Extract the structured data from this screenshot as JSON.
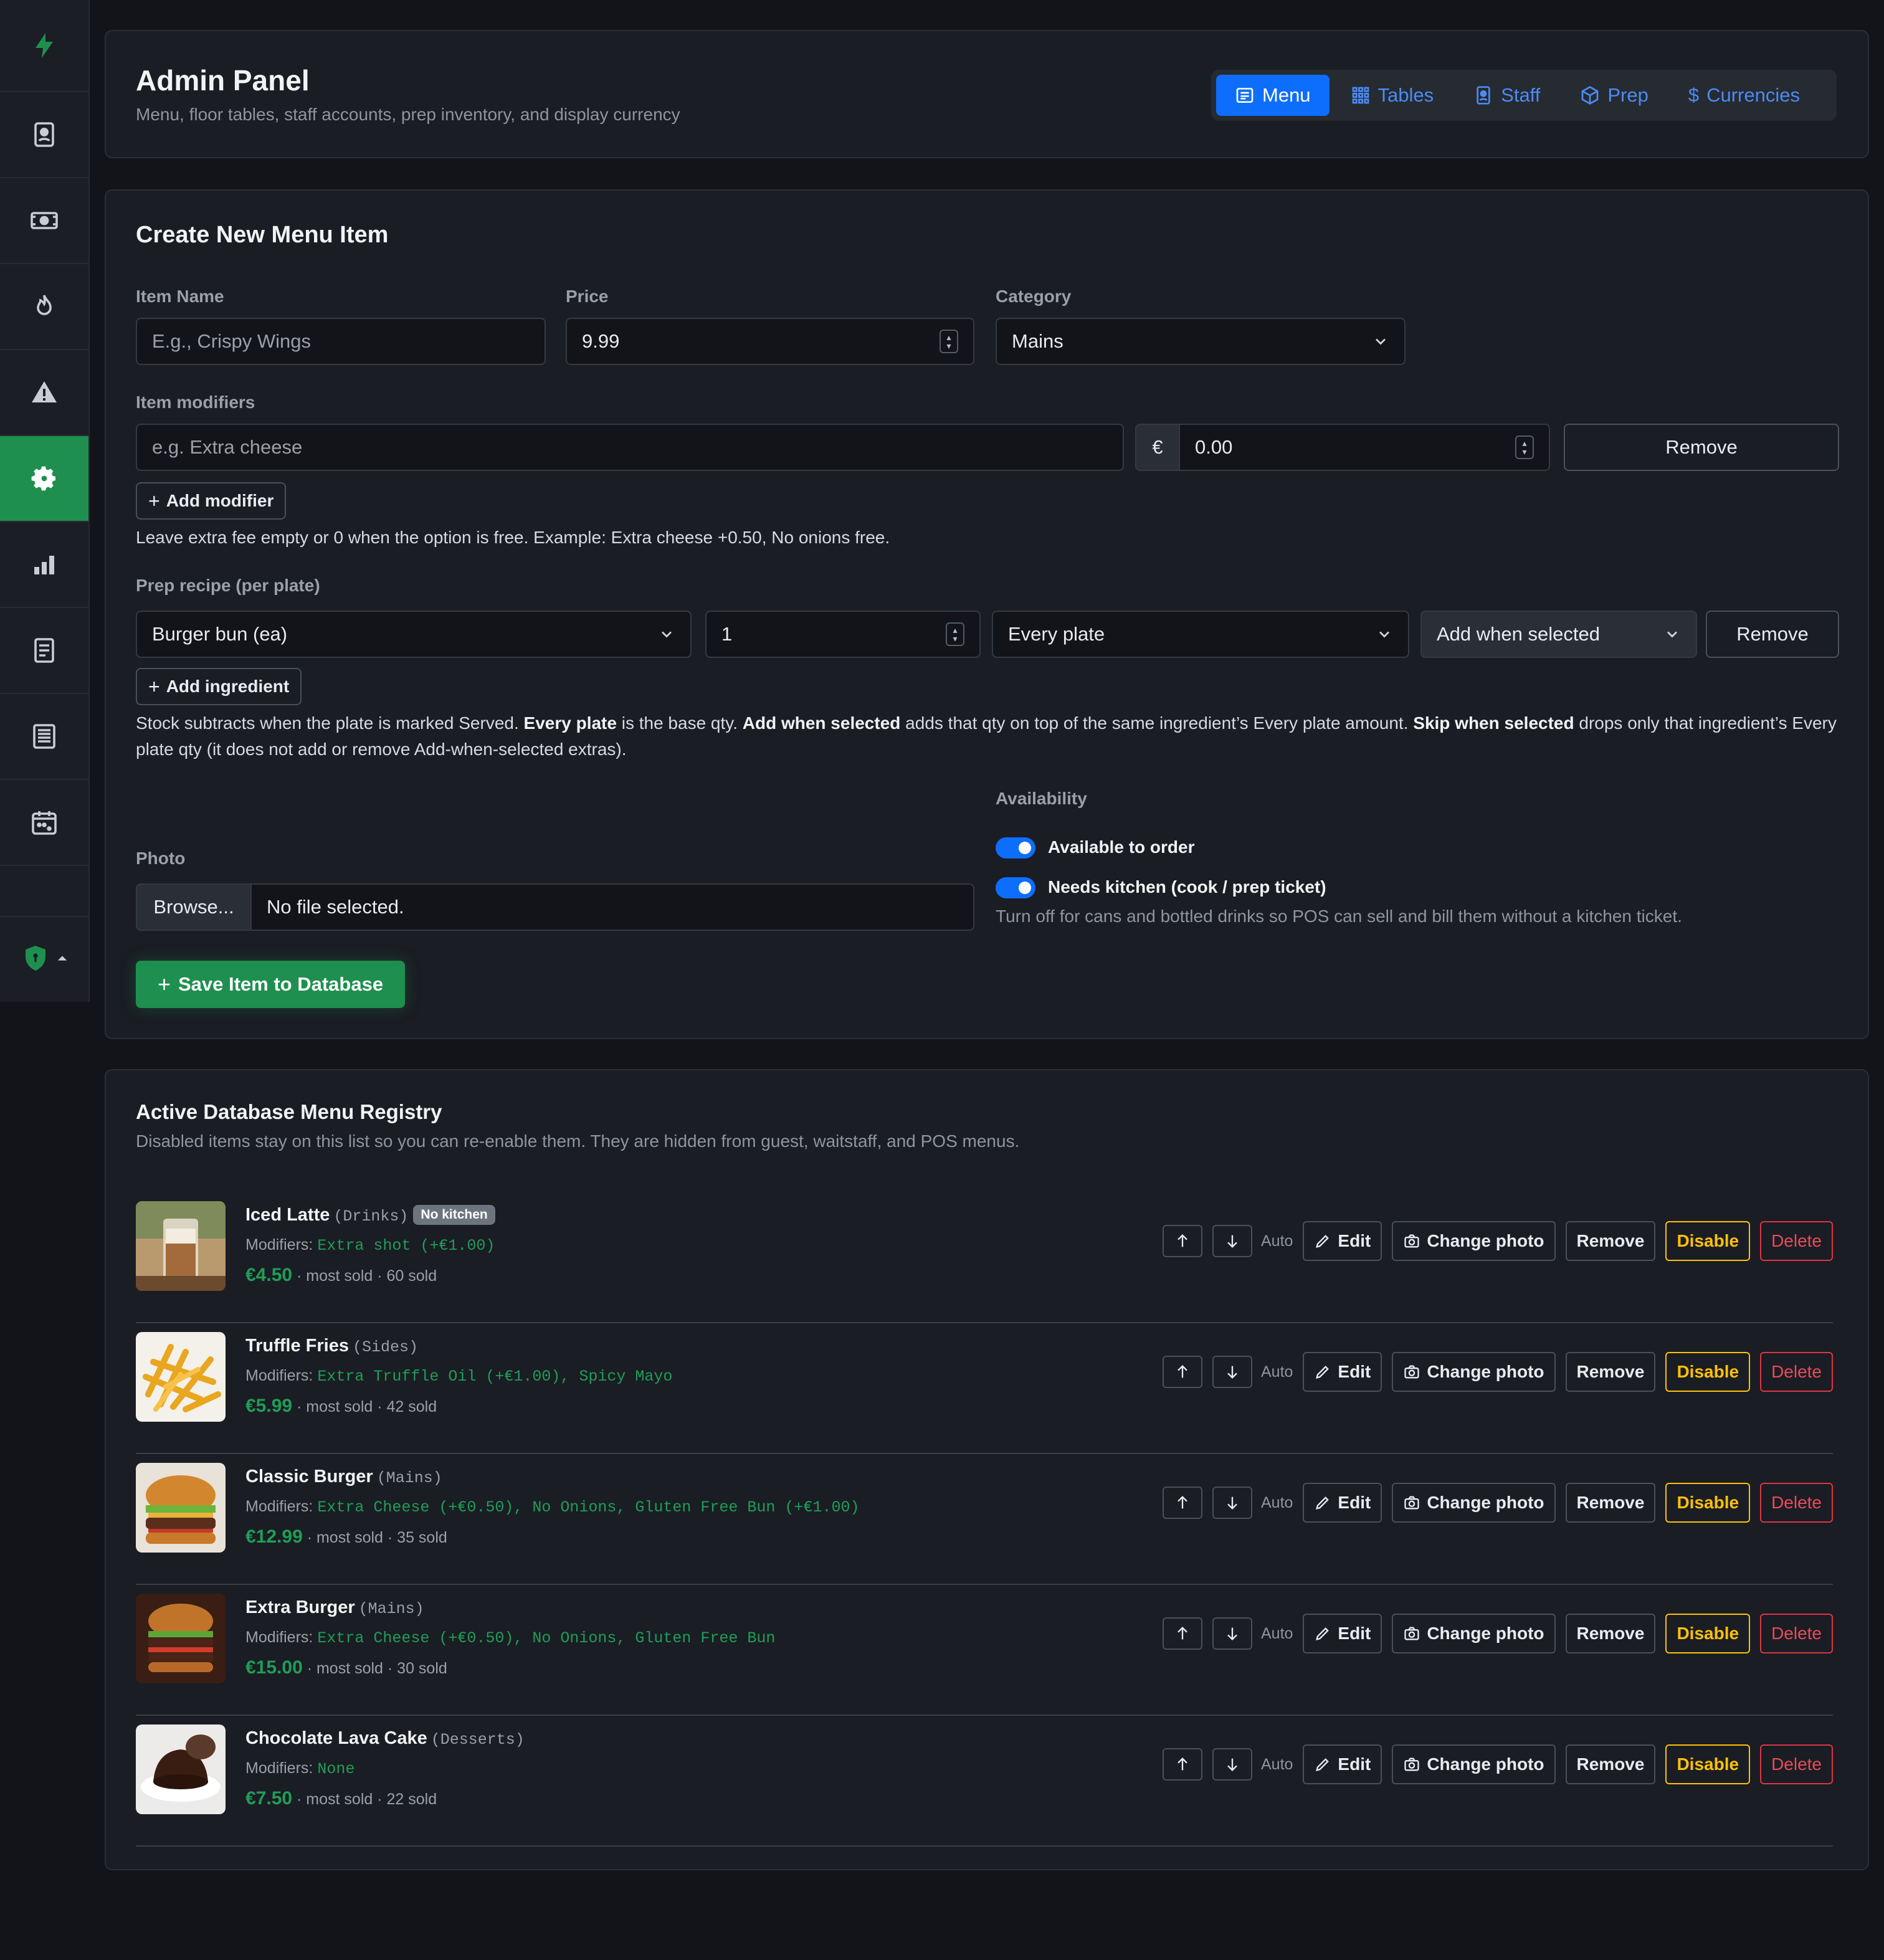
{
  "header": {
    "title": "Admin Panel",
    "subtitle": "Menu, floor tables, staff accounts, prep inventory, and display currency",
    "tabs": [
      {
        "label": "Menu",
        "icon": "menu-card-icon",
        "active": true
      },
      {
        "label": "Tables",
        "icon": "grid-icon",
        "active": false
      },
      {
        "label": "Staff",
        "icon": "badge-icon",
        "active": false
      },
      {
        "label": "Prep",
        "icon": "box-icon",
        "active": false
      },
      {
        "label": "Currencies",
        "icon": "dollar-icon",
        "active": false
      }
    ]
  },
  "sidebar": {
    "items": [
      "lightning-icon",
      "id-badge-icon",
      "cash-icon",
      "fire-icon",
      "warning-icon",
      "gear-icon",
      "bar-chart-icon",
      "receipt-icon",
      "document-list-icon",
      "calendar-icon"
    ],
    "active_index": 5,
    "footer_icon": "shield-icon",
    "accent": "#1e8f4e"
  },
  "form": {
    "title": "Create New Menu Item",
    "item_name_label": "Item Name",
    "item_name_placeholder": "E.g., Crispy Wings",
    "price_label": "Price",
    "price_value": "9.99",
    "category_label": "Category",
    "category_value": "Mains",
    "modifiers_label": "Item modifiers",
    "modifier_placeholder": "e.g. Extra cheese",
    "currency_symbol": "€",
    "modifier_fee_value": "0.00",
    "remove_label": "Remove",
    "add_modifier_label": "Add modifier",
    "modifier_help": "Leave extra fee empty or 0 when the option is free. Example: Extra cheese +0.50, No onions free.",
    "prep_label": "Prep recipe (per plate)",
    "prep_ingredient": "Burger bun (ea)",
    "prep_qty": "1",
    "prep_rule": "Every plate",
    "prep_mode": "Add when selected",
    "add_ingredient_label": "Add ingredient",
    "prep_help": {
      "t1": "Stock subtracts when the plate is marked Served. ",
      "b1": "Every plate",
      "t2": " is the base qty. ",
      "b2": "Add when selected",
      "t3": " adds that qty on top of the same ingredient’s Every plate amount. ",
      "b3": "Skip when selected",
      "t4": " drops only that ingredient’s Every plate qty (it does not add or remove Add-when-selected extras)."
    },
    "availability_label": "Availability",
    "available_label": "Available to order",
    "kitchen_label": "Needs kitchen (cook / prep ticket)",
    "kitchen_help": "Turn off for cans and bottled drinks so POS can sell and bill them without a kitchen ticket.",
    "photo_label": "Photo",
    "browse_label": "Browse...",
    "file_status": "No file selected.",
    "save_label": "Save Item to Database"
  },
  "registry": {
    "title": "Active Database Menu Registry",
    "subtitle": "Disabled items stay on this list so you can re-enable them. They are hidden from guest, waitstaff, and POS menus.",
    "modifiers_prefix": "Modifiers: ",
    "auto_label": "Auto",
    "actions": {
      "edit": "Edit",
      "change_photo": "Change photo",
      "remove": "Remove",
      "disable": "Disable",
      "delete": "Delete"
    },
    "items": [
      {
        "name": "Iced Latte",
        "category": "(Drinks)",
        "badge": "No kitchen",
        "modifiers": "Extra shot (+€1.00)",
        "price": "€4.50",
        "sales": " · most sold · 60 sold",
        "photo": "latte"
      },
      {
        "name": "Truffle Fries",
        "category": "(Sides)",
        "badge": "",
        "modifiers": "Extra Truffle Oil (+€1.00), Spicy Mayo",
        "price": "€5.99",
        "sales": " · most sold · 42 sold",
        "photo": "fries"
      },
      {
        "name": "Classic Burger",
        "category": "(Mains)",
        "badge": "",
        "modifiers": "Extra Cheese (+€0.50), No Onions, Gluten Free Bun (+€1.00)",
        "price": "€12.99",
        "sales": " · most sold · 35 sold",
        "photo": "burger"
      },
      {
        "name": "Extra Burger",
        "category": "(Mains)",
        "badge": "",
        "modifiers": "Extra Cheese (+€0.50), No Onions, Gluten Free Bun",
        "price": "€15.00",
        "sales": " · most sold · 30 sold",
        "photo": "burger2"
      },
      {
        "name": "Chocolate Lava Cake",
        "category": "(Desserts)",
        "badge": "",
        "modifiers": "None",
        "price": "€7.50",
        "sales": " · most sold · 22 sold",
        "photo": "cake"
      }
    ]
  }
}
